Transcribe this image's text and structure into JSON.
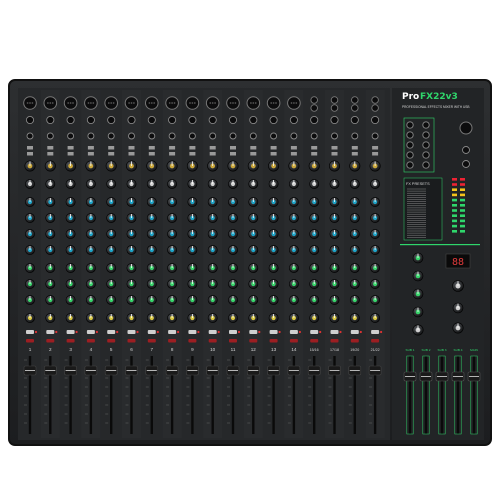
{
  "product": {
    "brand_prefix": "Pro",
    "model_suffix": "FX22v3",
    "tagline": "PROFESSIONAL EFFECTS MIXER WITH USB"
  },
  "channel_numbers": [
    "1",
    "2",
    "3",
    "4",
    "5",
    "6",
    "7",
    "8",
    "9",
    "10",
    "11",
    "12",
    "13",
    "14",
    "15/16",
    "17/18",
    "19/20",
    "21/22"
  ],
  "master": {
    "fx_presets_label": "FX PRESETS",
    "preset_count": 24,
    "display_value": "88",
    "group_label": "SUB",
    "bus_labels": [
      "SUB 1",
      "SUB 2",
      "SUB 3",
      "SUB 4",
      "MAIN"
    ]
  },
  "colors": {
    "chassis": "#232526",
    "panel": "#2c2e30",
    "accent": "#2fd66b",
    "knob_gain": "#c9a63a",
    "knob_eq": "#1ea4c8",
    "knob_aux": "#37d46a",
    "knob_pan": "#d7c63f",
    "mute": "#9c1e22"
  }
}
